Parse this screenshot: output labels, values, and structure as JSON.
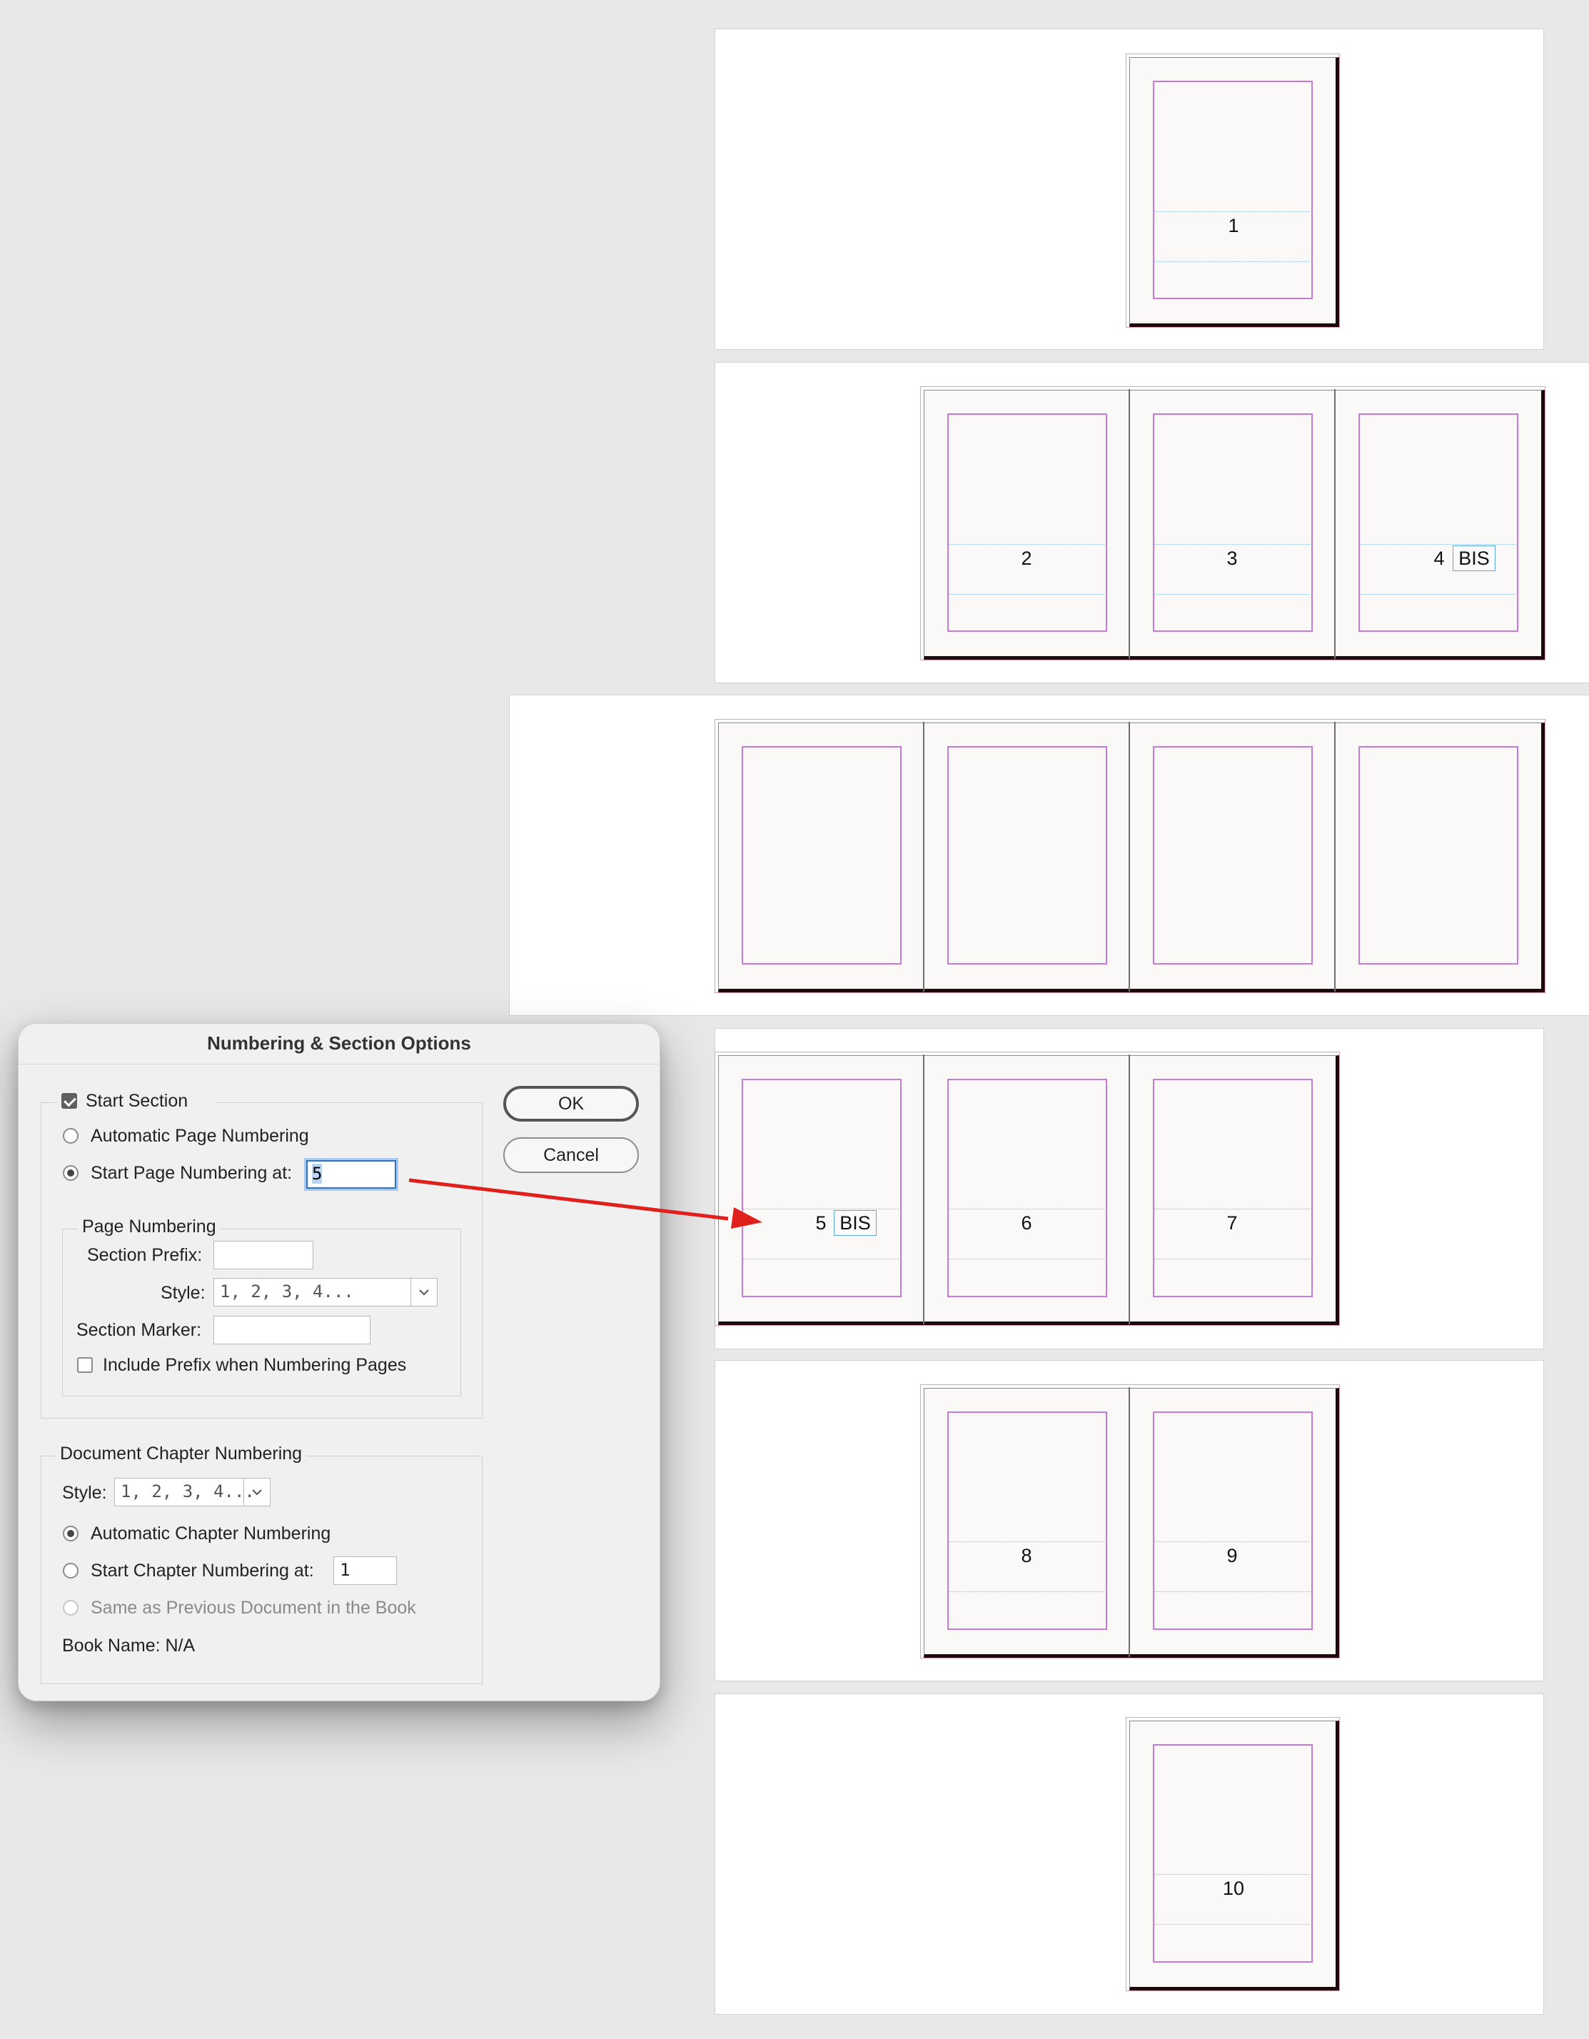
{
  "pages": {
    "p1": "1",
    "p2": "2",
    "p3": "3",
    "p4": "4",
    "p4_prefix": "BIS",
    "p5": "5",
    "p5_prefix": "BIS",
    "p6": "6",
    "p7": "7",
    "p8": "8",
    "p9": "9",
    "p10": "10"
  },
  "dialog": {
    "title": "Numbering & Section Options",
    "ok_label": "OK",
    "cancel_label": "Cancel",
    "start_section": {
      "label": "Start Section",
      "checked": true
    },
    "automatic_page_numbering": "Automatic Page Numbering",
    "start_page_numbering": {
      "label": "Start Page Numbering at:",
      "value": "5"
    },
    "page_numbering": {
      "legend": "Page Numbering",
      "section_prefix_label": "Section Prefix:",
      "section_prefix_value": "",
      "style_label": "Style:",
      "style_value": "1, 2, 3, 4...",
      "section_marker_label": "Section Marker:",
      "section_marker_value": "",
      "include_prefix_label": "Include Prefix when Numbering Pages"
    },
    "chapter": {
      "legend": "Document Chapter Numbering",
      "style_label": "Style:",
      "style_value": "1, 2, 3, 4...",
      "automatic_label": "Automatic Chapter Numbering",
      "start_label": "Start Chapter Numbering at:",
      "start_value": "1",
      "same_as_previous_label": "Same as Previous Document in the Book",
      "book_name_label": "Book Name: N/A"
    }
  },
  "colors": {
    "margin_guide": "#c77ad9",
    "annotation_arrow": "#e0201c",
    "focus_ring": "#2d73c9"
  }
}
